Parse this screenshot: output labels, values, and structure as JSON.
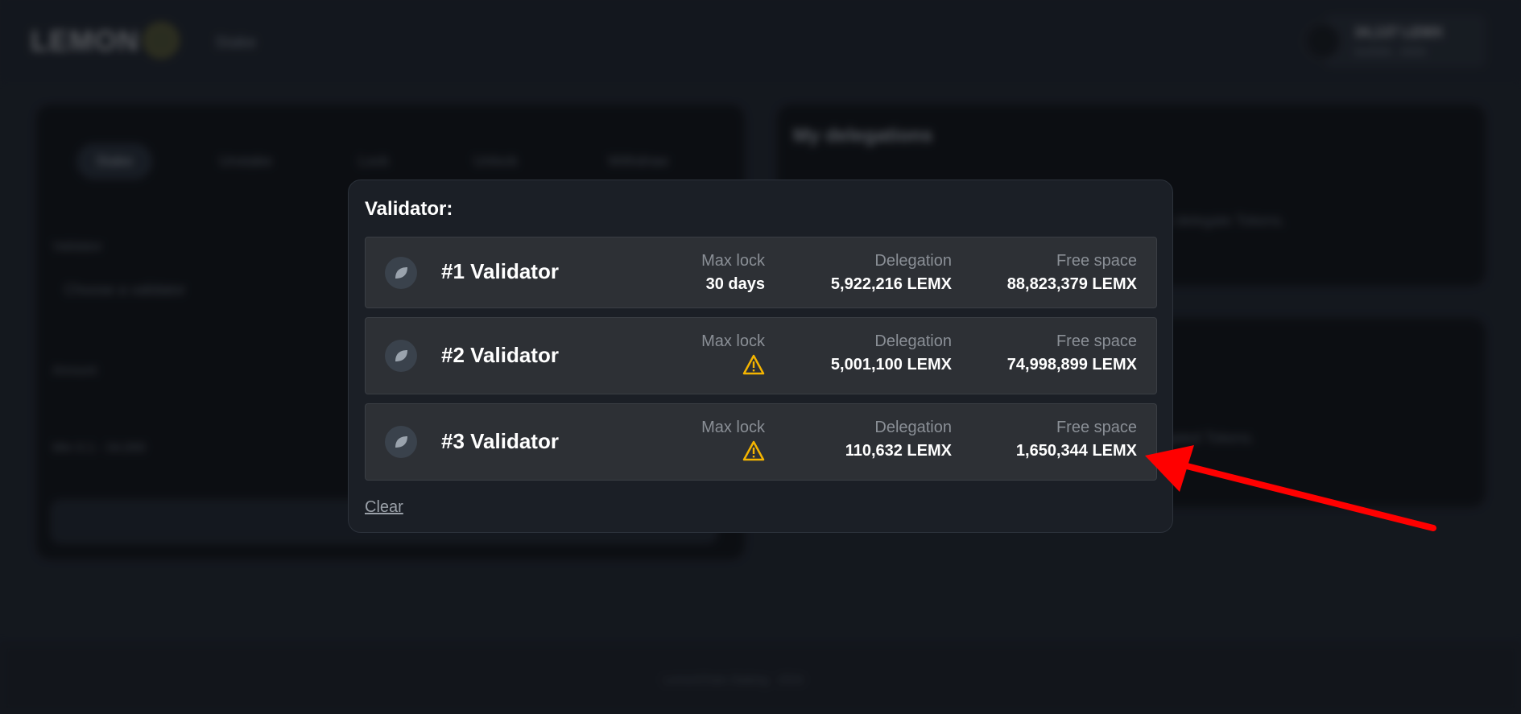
{
  "background": {
    "logo_text": "LEMON",
    "nav_stake": "Stake",
    "wallet_title": "34,137 LEMX",
    "wallet_sub": "0x0000...0000",
    "tabs": [
      "Stake",
      "Unstake",
      "Lock",
      "Unlock",
      "Withdraw"
    ],
    "left_labels": [
      "Validator",
      "Choose a validator",
      "Amount",
      "Min 0.1 - 34,000"
    ],
    "right_title": "My delegations",
    "right_text_1": "You have no delegations yet. Choose a validator to delegate Tokens.",
    "right_text_2": "You have no pending withdrawals of delegated Tokens.",
    "footer_text": "LemonChain Staking · 2024"
  },
  "modal": {
    "title": "Validator:",
    "col_labels": {
      "max_lock": "Max lock",
      "delegation": "Delegation",
      "free_space": "Free space"
    },
    "validators": [
      {
        "name": "#1 Validator",
        "max_lock": "30 days",
        "max_lock_warning": false,
        "delegation": "5,922,216 LEMX",
        "free_space": "88,823,379 LEMX"
      },
      {
        "name": "#2 Validator",
        "max_lock": "",
        "max_lock_warning": true,
        "delegation": "5,001,100 LEMX",
        "free_space": "74,998,899 LEMX"
      },
      {
        "name": "#3 Validator",
        "max_lock": "",
        "max_lock_warning": true,
        "delegation": "110,632 LEMX",
        "free_space": "1,650,344 LEMX"
      }
    ],
    "clear_label": "Clear"
  },
  "colors": {
    "accent_warning": "#f4b400",
    "arrow": "#ff0000",
    "modal_bg": "#1b1f26",
    "row_bg": "#2d3035"
  },
  "icons": {
    "validator": "leaf-icon",
    "warning": "warning-triangle-icon"
  }
}
